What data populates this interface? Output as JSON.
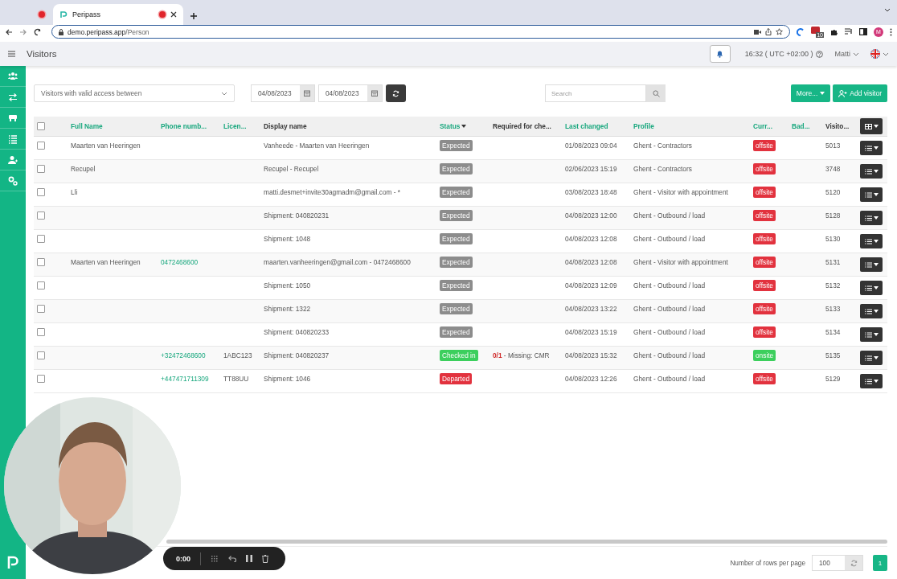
{
  "browser": {
    "tabs": [
      {
        "recording": true,
        "selected": false
      },
      {
        "title": "Peripass",
        "recording": true,
        "selected": true
      }
    ],
    "url_host": "demo.peripass.app",
    "url_path": "/Person",
    "profile_initial": "M",
    "extension_count": "10"
  },
  "header": {
    "title": "Visitors",
    "time": "16:32 ( UTC +02:00 )",
    "user": "Matti"
  },
  "sidebar": {
    "items": [
      {
        "selected": false
      },
      {
        "selected": false
      },
      {
        "selected": false
      },
      {
        "selected": false
      },
      {
        "selected": false
      },
      {
        "selected": false
      }
    ]
  },
  "filters": {
    "access_filter": "Visitors with valid access between",
    "date_from": "04/08/2023",
    "date_to": "04/08/2023",
    "search": {
      "placeholder": "Search"
    },
    "more_button": "More...",
    "add_button": "Add visitor"
  },
  "table": {
    "columns": [
      {
        "label": "Full Name",
        "sortable": true,
        "sorted": false
      },
      {
        "label": "Phone numb...",
        "sortable": true,
        "sorted": false
      },
      {
        "label": "Licen...",
        "sortable": true,
        "sorted": false
      },
      {
        "label": "Display name",
        "sortable": false,
        "sorted": false
      },
      {
        "label": "Status",
        "sortable": true,
        "sorted": true
      },
      {
        "label": "Required for che...",
        "sortable": false,
        "sorted": false
      },
      {
        "label": "Last changed",
        "sortable": true,
        "sorted": false
      },
      {
        "label": "Profile",
        "sortable": true,
        "sorted": false
      },
      {
        "label": "Curr...",
        "sortable": true,
        "sorted": false
      },
      {
        "label": "Bad...",
        "sortable": true,
        "sorted": false
      },
      {
        "label": "Visito...",
        "sortable": false,
        "sorted": false
      }
    ],
    "all_checked": false,
    "rows": [
      {
        "checked": false,
        "full_name": "Maarten van Heeringen",
        "display_name": "Vanheede - Maarten van Heeringen",
        "status": {
          "label": "Expected",
          "kind": "expected"
        },
        "last_changed": "01/08/2023 09:04",
        "profile": "Ghent - Contractors",
        "current": {
          "label": "offsite",
          "kind": "offsite"
        },
        "visitor_id": "5013"
      },
      {
        "checked": false,
        "full_name": "Recupel",
        "display_name": "Recupel - Recupel",
        "status": {
          "label": "Expected",
          "kind": "expected"
        },
        "last_changed": "02/06/2023 15:19",
        "profile": "Ghent - Contractors",
        "current": {
          "label": "offsite",
          "kind": "offsite"
        },
        "visitor_id": "3748"
      },
      {
        "checked": false,
        "full_name": "Lli",
        "display_name": "matti.desmet+invite30agmadm@gmail.com - *",
        "status": {
          "label": "Expected",
          "kind": "expected"
        },
        "last_changed": "03/08/2023 18:48",
        "profile": "Ghent - Visitor with appointment",
        "current": {
          "label": "offsite",
          "kind": "offsite"
        },
        "visitor_id": "5120"
      },
      {
        "checked": false,
        "display_name": "Shipment: 040820231",
        "status": {
          "label": "Expected",
          "kind": "expected"
        },
        "last_changed": "04/08/2023 12:00",
        "profile": "Ghent - Outbound / load",
        "current": {
          "label": "offsite",
          "kind": "offsite"
        },
        "visitor_id": "5128"
      },
      {
        "checked": false,
        "display_name": "Shipment: 1048",
        "status": {
          "label": "Expected",
          "kind": "expected"
        },
        "last_changed": "04/08/2023 12:08",
        "profile": "Ghent - Outbound / load",
        "current": {
          "label": "offsite",
          "kind": "offsite"
        },
        "visitor_id": "5130"
      },
      {
        "checked": false,
        "full_name": "Maarten van Heeringen",
        "phone": "0472468600",
        "display_name": "maarten.vanheeringen@gmail.com - 0472468600",
        "status": {
          "label": "Expected",
          "kind": "expected"
        },
        "last_changed": "04/08/2023 12:08",
        "profile": "Ghent - Visitor with appointment",
        "current": {
          "label": "offsite",
          "kind": "offsite"
        },
        "visitor_id": "5131"
      },
      {
        "checked": false,
        "display_name": "Shipment: 1050",
        "status": {
          "label": "Expected",
          "kind": "expected"
        },
        "last_changed": "04/08/2023 12:09",
        "profile": "Ghent - Outbound / load",
        "current": {
          "label": "offsite",
          "kind": "offsite"
        },
        "visitor_id": "5132"
      },
      {
        "checked": false,
        "display_name": "Shipment: 1322",
        "status": {
          "label": "Expected",
          "kind": "expected"
        },
        "last_changed": "04/08/2023 13:22",
        "profile": "Ghent - Outbound / load",
        "current": {
          "label": "offsite",
          "kind": "offsite"
        },
        "visitor_id": "5133"
      },
      {
        "checked": false,
        "display_name": "Shipment: 040820233",
        "status": {
          "label": "Expected",
          "kind": "expected"
        },
        "last_changed": "04/08/2023 15:19",
        "profile": "Ghent - Outbound / load",
        "current": {
          "label": "offsite",
          "kind": "offsite"
        },
        "visitor_id": "5134"
      },
      {
        "checked": false,
        "phone": "+32472468600",
        "license": "1ABC123",
        "display_name": "Shipment: 040820237",
        "status": {
          "label": "Checked in",
          "kind": "checked_in"
        },
        "required": "**0/1** - Missing: CMR",
        "last_changed": "04/08/2023 15:32",
        "profile": "Ghent - Outbound / load",
        "current": {
          "label": "onsite",
          "kind": "onsite"
        },
        "visitor_id": "5135"
      },
      {
        "checked": false,
        "phone": "+447471711309",
        "license": "TT88UU",
        "display_name": "Shipment: 1046",
        "status": {
          "label": "Departed",
          "kind": "departed"
        },
        "last_changed": "04/08/2023 12:26",
        "profile": "Ghent - Outbound / load",
        "current": {
          "label": "offsite",
          "kind": "offsite"
        },
        "visitor_id": "5129"
      }
    ]
  },
  "footer": {
    "rows_label": "Number of rows per page",
    "rows_per_page": "100",
    "pages": [
      {
        "label": "1",
        "selected": true
      }
    ]
  },
  "recorder": {
    "time": "0:00"
  }
}
